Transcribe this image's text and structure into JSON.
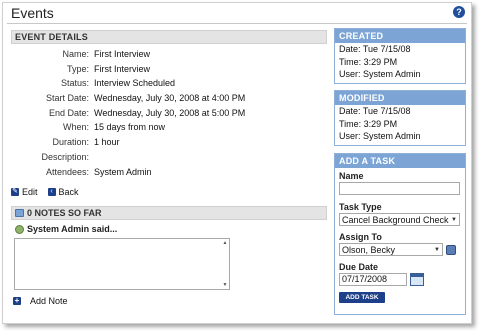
{
  "window": {
    "title": "Events"
  },
  "event_details": {
    "heading": "EVENT DETAILS",
    "rows": [
      {
        "label": "Name:",
        "value": "First Interview"
      },
      {
        "label": "Type:",
        "value": "First Interview"
      },
      {
        "label": "Status:",
        "value": "Interview Scheduled"
      },
      {
        "label": "Start Date:",
        "value": "Wednesday, July 30, 2008 at 4:00 PM"
      },
      {
        "label": "End Date:",
        "value": "Wednesday, July 30, 2008 at 5:00 PM"
      },
      {
        "label": "When:",
        "value": "15 days from now"
      },
      {
        "label": "Duration:",
        "value": "1 hour"
      },
      {
        "label": "Description:",
        "value": ""
      },
      {
        "label": "Attendees:",
        "value": "System Admin"
      }
    ]
  },
  "actions": {
    "edit_label": "Edit",
    "back_label": "Back"
  },
  "notes": {
    "heading": "0 NOTES SO FAR",
    "author_line": "System Admin said...",
    "note_value": "",
    "add_note_label": "Add Note"
  },
  "created": {
    "heading": "CREATED",
    "date": "Date: Tue 7/15/08",
    "time": "Time: 3:29 PM",
    "user": "User: System Admin"
  },
  "modified": {
    "heading": "MODIFIED",
    "date": "Date: Tue 7/15/08",
    "time": "Time: 3:29 PM",
    "user": "User: System Admin"
  },
  "add_task": {
    "heading": "ADD A TASK",
    "name_label": "Name",
    "name_value": "",
    "task_type_label": "Task Type",
    "task_type_value": "Cancel Background Check",
    "assign_to_label": "Assign To",
    "assign_to_value": "Olson, Becky",
    "due_date_label": "Due Date",
    "due_date_value": "07/17/2008",
    "button_label": "ADD TASK"
  },
  "icons": {
    "help": "help-icon",
    "edit": "edit-icon",
    "back": "back-icon",
    "notes": "notes-icon",
    "user": "user-icon",
    "add": "plus-icon",
    "contact": "contact-lookup-icon",
    "calendar": "calendar-icon"
  },
  "colors": {
    "panel_header": "#7ca5d6",
    "button": "#1e3f8a",
    "section_header": "#e4e4e4"
  }
}
